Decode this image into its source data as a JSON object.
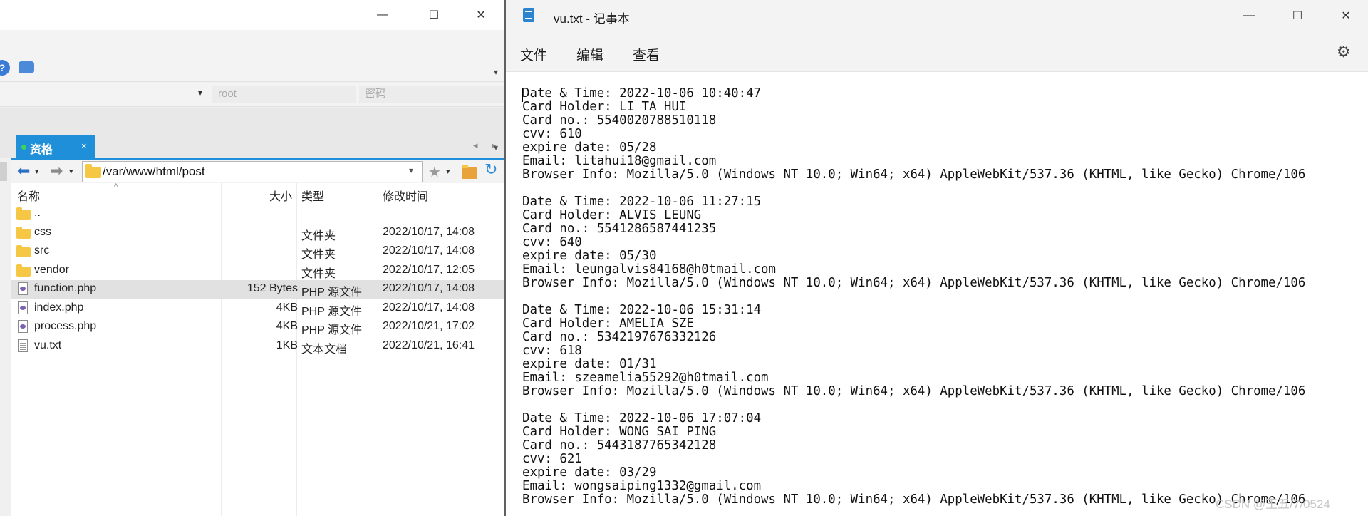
{
  "left_window": {
    "controls": {
      "minimize": "—",
      "maximize": "☐",
      "close": "✕"
    },
    "connection": {
      "user_value": "root",
      "password_placeholder": "密码",
      "dropdown_arrow": "▾"
    },
    "menubar_more": "▾",
    "tab": {
      "label": "资格",
      "close": "×"
    },
    "tab_nav": {
      "prev": "◂",
      "next": "▸",
      "menu": "▾"
    },
    "path": {
      "value": "/var/www/html/post",
      "dropdown": "▾"
    },
    "nav": {
      "back": "⬅",
      "forward": "➡",
      "back_menu": "▾",
      "forward_menu": "▾",
      "bookmark": "★",
      "bookmark_menu": "▾",
      "refresh": "↻"
    },
    "columns": {
      "name": "名称",
      "size": "大小",
      "type": "类型",
      "modified": "修改时间",
      "sort_indicator": "^"
    },
    "files": [
      {
        "name": "..",
        "size": "",
        "type": "",
        "modified": "",
        "icon": "folder"
      },
      {
        "name": "css",
        "size": "",
        "type": "文件夹",
        "modified": "2022/10/17, 14:08",
        "icon": "folder"
      },
      {
        "name": "src",
        "size": "",
        "type": "文件夹",
        "modified": "2022/10/17, 14:08",
        "icon": "folder"
      },
      {
        "name": "vendor",
        "size": "",
        "type": "文件夹",
        "modified": "2022/10/17, 12:05",
        "icon": "folder"
      },
      {
        "name": "function.php",
        "size": "152 Bytes",
        "type": "PHP 源文件",
        "modified": "2022/10/17, 14:08",
        "icon": "php-file",
        "selected": true
      },
      {
        "name": "index.php",
        "size": "4KB",
        "type": "PHP 源文件",
        "modified": "2022/10/17, 14:08",
        "icon": "php-file"
      },
      {
        "name": "process.php",
        "size": "4KB",
        "type": "PHP 源文件",
        "modified": "2022/10/21, 17:02",
        "icon": "php-file"
      },
      {
        "name": "vu.txt",
        "size": "1KB",
        "type": "文本文档",
        "modified": "2022/10/21, 16:41",
        "icon": "text-file"
      }
    ],
    "accent_color": "#1e8fd8"
  },
  "notepad": {
    "title": "vu.txt - 记事本",
    "menus": {
      "file": "文件",
      "edit": "编辑",
      "view": "查看"
    },
    "settings_icon": "⚙",
    "controls": {
      "minimize": "—",
      "maximize": "☐",
      "close": "✕"
    },
    "content": "Date & Time: 2022-10-06 10:40:47\nCard Holder: LI TA HUI\nCard no.: 5540020788510118\ncvv: 610\nexpire date: 05/28\nEmail: litahui18@gmail.com\nBrowser Info: Mozilla/5.0 (Windows NT 10.0; Win64; x64) AppleWebKit/537.36 (KHTML, like Gecko) Chrome/106\n\nDate & Time: 2022-10-06 11:27:15\nCard Holder: ALVIS LEUNG\nCard no.: 5541286587441235\ncvv: 640\nexpire date: 05/30\nEmail: leungalvis84168@h0tmail.com\nBrowser Info: Mozilla/5.0 (Windows NT 10.0; Win64; x64) AppleWebKit/537.36 (KHTML, like Gecko) Chrome/106\n\nDate & Time: 2022-10-06 15:31:14\nCard Holder: AMELIA SZE\nCard no.: 5342197676332126\ncvv: 618\nexpire date: 01/31\nEmail: szeamelia55292@h0tmail.com\nBrowser Info: Mozilla/5.0 (Windows NT 10.0; Win64; x64) AppleWebKit/537.36 (KHTML, like Gecko) Chrome/106\n\nDate & Time: 2022-10-06 17:07:04\nCard Holder: WONG SAI PING\nCard no.: 5443187765342128\ncvv: 621\nexpire date: 03/29\nEmail: wongsaiping1332@gmail.com\nBrowser Info: Mozilla/5.0 (Windows NT 10.0; Win64; x64) AppleWebKit/537.36 (KHTML, like Gecko) Chrome/106",
    "watermark": "CSDN @王五/7/0524"
  }
}
